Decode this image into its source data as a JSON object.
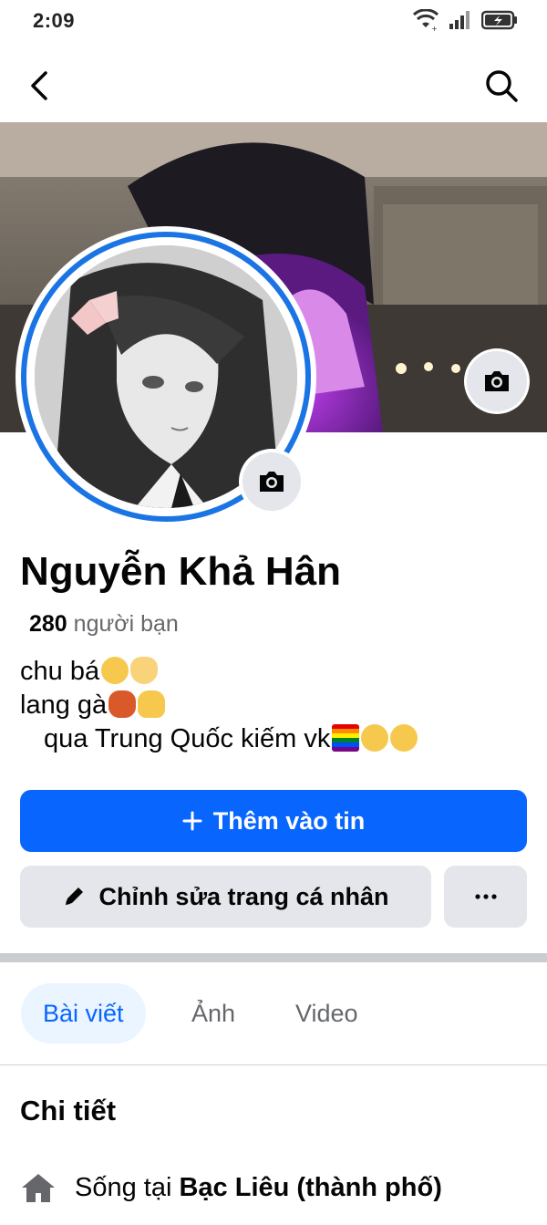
{
  "status_bar": {
    "time": "2:09",
    "icons": [
      "wifi-icon",
      "signal-icon",
      "battery-charging-icon"
    ]
  },
  "nav": {
    "back_icon": "back-arrow-icon",
    "search_icon": "search-icon"
  },
  "profile": {
    "name": "Nguyễn Khả Hân",
    "friends_count": "280",
    "friends_label": "người bạn",
    "bio": {
      "line1_text": "chu bá",
      "line1_emojis": [
        "😮‍💨",
        "🫶"
      ],
      "line2_text": "lang gà",
      "line2_emojis": [
        "🐓",
        "🤞"
      ],
      "line3_text": "qua Trung Quốc kiếm vk",
      "line3_emojis": [
        "🏳️‍🌈",
        "😋",
        "😋"
      ]
    }
  },
  "actions": {
    "add_story_label": "Thêm vào tin",
    "edit_profile_label": "Chỉnh sửa trang cá nhân",
    "more_label": "···"
  },
  "tabs": [
    {
      "label": "Bài viết",
      "active": true
    },
    {
      "label": "Ảnh",
      "active": false
    },
    {
      "label": "Video",
      "active": false
    }
  ],
  "details": {
    "title": "Chi tiết",
    "lives_in_prefix": "Sống tại",
    "lives_in_place": "Bạc Liêu (thành phố)"
  },
  "colors": {
    "primary_blue": "#0866ff",
    "ring_blue": "#1b74e4",
    "button_gray": "#e4e6eb",
    "tab_active_bg": "#ebf5ff",
    "secondary_text": "#65676b"
  }
}
